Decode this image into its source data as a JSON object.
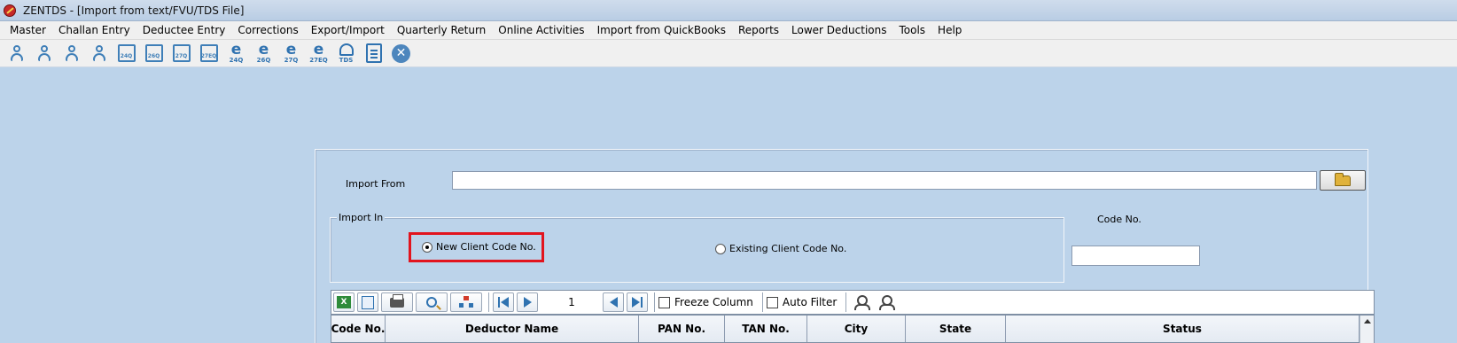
{
  "window": {
    "title": "ZENTDS - [Import from text/FVU/TDS File]"
  },
  "menu": [
    {
      "label": "Master",
      "name": "menu-master"
    },
    {
      "label": "Challan Entry",
      "name": "menu-challan-entry"
    },
    {
      "label": "Deductee Entry",
      "name": "menu-deductee-entry"
    },
    {
      "label": "Corrections",
      "name": "menu-corrections"
    },
    {
      "label": "Export/Import",
      "name": "menu-export-import"
    },
    {
      "label": "Quarterly Return",
      "name": "menu-quarterly-return"
    },
    {
      "label": "Online Activities",
      "name": "menu-online-activities"
    },
    {
      "label": "Import from QuickBooks",
      "name": "menu-import-quickbooks"
    },
    {
      "label": "Reports",
      "name": "menu-reports"
    },
    {
      "label": "Lower Deductions",
      "name": "menu-lower-deductions"
    },
    {
      "label": "Tools",
      "name": "menu-tools"
    },
    {
      "label": "Help",
      "name": "menu-help"
    }
  ],
  "toolbar": {
    "icons": [
      {
        "name": "deductor-icon",
        "type": "person",
        "text": ""
      },
      {
        "name": "deductees-icon",
        "type": "person",
        "text": ""
      },
      {
        "name": "party-master-icon",
        "type": "person",
        "text": ""
      },
      {
        "name": "employee-master-icon",
        "type": "person",
        "text": ""
      },
      {
        "name": "form-24q-icon",
        "type": "form",
        "text": "24Q"
      },
      {
        "name": "form-26q-icon",
        "type": "form",
        "text": "26Q"
      },
      {
        "name": "form-27q-icon",
        "type": "form",
        "text": "27Q"
      },
      {
        "name": "form-27eq-icon",
        "type": "form",
        "text": "27EQ"
      },
      {
        "name": "e-return-24q-icon",
        "type": "e",
        "text": "24Q"
      },
      {
        "name": "e-return-26q-icon",
        "type": "e",
        "text": "26Q"
      },
      {
        "name": "e-return-27q-icon",
        "type": "e",
        "text": "27Q"
      },
      {
        "name": "e-return-27eq-icon",
        "type": "e",
        "text": "27EQ"
      },
      {
        "name": "tds-icon",
        "type": "tds",
        "text": "TDS"
      },
      {
        "name": "report-icon",
        "type": "doc",
        "text": ""
      },
      {
        "name": "close-icon",
        "type": "close",
        "text": "✕"
      }
    ]
  },
  "form": {
    "import_from_label": "Import From",
    "import_from_value": "",
    "import_in_label": "Import In",
    "new_client_label": "New Client Code No.",
    "existing_client_label": "Existing Client Code No.",
    "selected_option": "new",
    "code_no_label": "Code No.",
    "code_no_value": ""
  },
  "grid": {
    "page_number": "1",
    "freeze_column_label": "Freeze Column",
    "auto_filter_label": "Auto Filter",
    "columns": [
      {
        "label": "Code No.",
        "w": 61
      },
      {
        "label": "Deductor Name",
        "w": 286
      },
      {
        "label": "PAN No.",
        "w": 97
      },
      {
        "label": "TAN No.",
        "w": 93
      },
      {
        "label": "City",
        "w": 111
      },
      {
        "label": "State",
        "w": 113
      },
      {
        "label": "Status",
        "w": 399
      }
    ]
  }
}
